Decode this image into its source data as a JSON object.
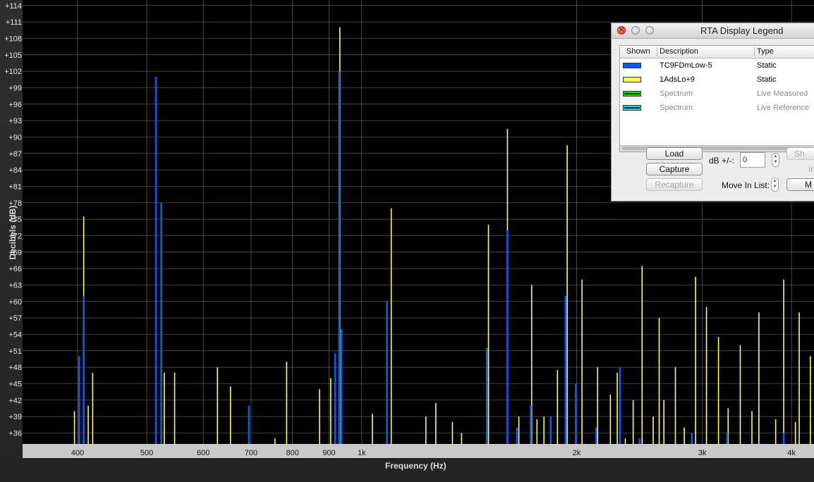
{
  "chart_data": {
    "type": "bar",
    "title": "",
    "xlabel": "Frequency (Hz)",
    "ylabel": "Decibels (dB)",
    "xscale": "log",
    "xlim": [
      335,
      4300
    ],
    "ylim": [
      34,
      115
    ],
    "grid": true,
    "legend": "top-right window",
    "y_ticks": [
      "+36",
      "+39",
      "+42",
      "+45",
      "+48",
      "+51",
      "+54",
      "+57",
      "+60",
      "+63",
      "+66",
      "+69",
      "+72",
      "+75",
      "+78",
      "+81",
      "+84",
      "+87",
      "+90",
      "+93",
      "+96",
      "+99",
      "+102",
      "+105",
      "+108",
      "+111",
      "+114"
    ],
    "y_tick_values": [
      36,
      39,
      42,
      45,
      48,
      51,
      54,
      57,
      60,
      63,
      66,
      69,
      72,
      75,
      78,
      81,
      84,
      87,
      90,
      93,
      96,
      99,
      102,
      105,
      108,
      111,
      114
    ],
    "x_ticks": [
      {
        "label": "400",
        "value": 400
      },
      {
        "label": "500",
        "value": 500
      },
      {
        "label": "600",
        "value": 600
      },
      {
        "label": "700",
        "value": 700
      },
      {
        "label": "800",
        "value": 800
      },
      {
        "label": "900",
        "value": 900
      },
      {
        "label": "1k",
        "value": 1000
      },
      {
        "label": "2k",
        "value": 2000
      },
      {
        "label": "3k",
        "value": 3000
      },
      {
        "label": "4k",
        "value": 4000
      }
    ],
    "x_gridlines": [
      400,
      500,
      600,
      700,
      800,
      900,
      1000,
      2000,
      3000,
      4000
    ],
    "series": [
      {
        "name": "1AdsLo+9",
        "color": "#ffff55",
        "points": [
          [
            408,
            75.5
          ],
          [
            420,
            47
          ],
          [
            414,
            41
          ],
          [
            396,
            40
          ],
          [
            529,
            47
          ],
          [
            547,
            47
          ],
          [
            628,
            48
          ],
          [
            655,
            44.5
          ],
          [
            785,
            49
          ],
          [
            756,
            35
          ],
          [
            873,
            44
          ],
          [
            905,
            46
          ],
          [
            932,
            110
          ],
          [
            1035,
            39.5
          ],
          [
            1100,
            77
          ],
          [
            1230,
            39
          ],
          [
            1270,
            41.5
          ],
          [
            1340,
            38
          ],
          [
            1380,
            36
          ],
          [
            1505,
            74
          ],
          [
            1600,
            91.5
          ],
          [
            1660,
            39
          ],
          [
            1730,
            63
          ],
          [
            1760,
            38.5
          ],
          [
            1800,
            39
          ],
          [
            1880,
            47.5
          ],
          [
            1940,
            88.5
          ],
          [
            2035,
            64
          ],
          [
            2140,
            48
          ],
          [
            2230,
            43
          ],
          [
            2280,
            47
          ],
          [
            2340,
            35
          ],
          [
            2400,
            42
          ],
          [
            2470,
            66.5
          ],
          [
            2560,
            39
          ],
          [
            2610,
            57
          ],
          [
            2650,
            42
          ],
          [
            2750,
            48
          ],
          [
            2830,
            37
          ],
          [
            2935,
            64.5
          ],
          [
            3040,
            59
          ],
          [
            3160,
            53.5
          ],
          [
            3260,
            40.5
          ],
          [
            3390,
            52
          ],
          [
            3520,
            40
          ],
          [
            3600,
            58
          ],
          [
            3800,
            38.5
          ],
          [
            3900,
            64
          ],
          [
            4050,
            38
          ],
          [
            4100,
            58
          ],
          [
            4250,
            50
          ]
        ]
      },
      {
        "name": "TC9FDmLow-5",
        "color": "#0a5cf5",
        "points": [
          [
            408,
            61
          ],
          [
            402,
            50
          ],
          [
            515,
            101
          ],
          [
            524,
            78
          ],
          [
            695,
            41
          ],
          [
            930,
            102
          ],
          [
            937,
            55
          ],
          [
            918,
            50.5
          ],
          [
            1085,
            60
          ],
          [
            1497,
            51.5
          ],
          [
            1600,
            73
          ],
          [
            1650,
            37
          ],
          [
            1725,
            41
          ],
          [
            1840,
            39
          ],
          [
            1930,
            61
          ],
          [
            1995,
            45
          ],
          [
            2130,
            37
          ],
          [
            2300,
            48
          ],
          [
            2450,
            35
          ],
          [
            2900,
            36
          ],
          [
            3250,
            36
          ],
          [
            3900,
            36
          ]
        ]
      }
    ]
  },
  "legend_window": {
    "title": "RTA Display Legend",
    "columns": [
      "Shown",
      "Description",
      "Type"
    ],
    "rows": [
      {
        "description": "TC9FDmLow-5",
        "type": "Static",
        "color": "#0a5cf5",
        "dim": false
      },
      {
        "description": "1AdsLo+9",
        "type": "Static",
        "color": "#ffff55",
        "dim": false
      },
      {
        "description": "Spectrum",
        "type": "Live Measured",
        "color": "#2bd62b",
        "dim": true
      },
      {
        "description": "Spectrum",
        "type": "Live Reference",
        "color": "#30d6e6",
        "dim": true
      }
    ],
    "load_label": "Load",
    "capture_label": "Capture",
    "recapture_label": "Recapture",
    "db_label": "dB +/-:",
    "db_value": "0",
    "move_label": "Move In List:",
    "btn_show_partial": "Sh",
    "btn_im_partial": "Im",
    "btn_m_partial": "M"
  }
}
